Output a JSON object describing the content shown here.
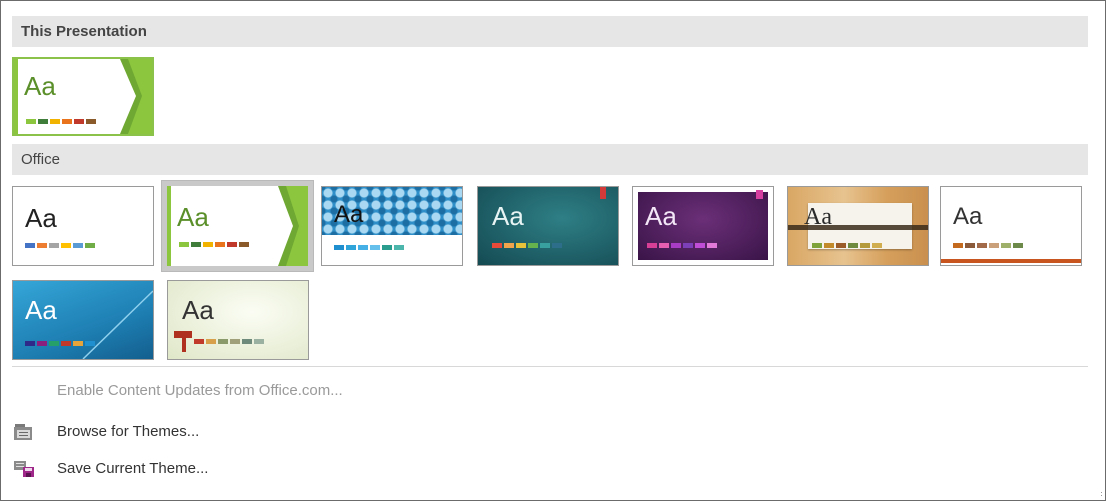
{
  "sections": {
    "this_presentation": "This Presentation",
    "office": "Office"
  },
  "thumbs": {
    "current": {
      "label": "Aa",
      "swatches": [
        "#8cc63f",
        "#3f7d3a",
        "#f2b200",
        "#e8731c",
        "#c0392b",
        "#8a5a2b"
      ]
    },
    "office_theme": {
      "label": "Aa",
      "swatches": [
        "#4472c4",
        "#ed7d31",
        "#a5a5a5",
        "#ffc000",
        "#5b9bd5",
        "#70ad47"
      ]
    },
    "facet": {
      "label": "Aa",
      "swatches": [
        "#8cc63f",
        "#3f7d3a",
        "#f2b200",
        "#e8731c",
        "#c0392b",
        "#8a5a2b"
      ]
    },
    "pattern": {
      "label": "Aa",
      "swatches": [
        "#1f8fcf",
        "#2fa4d8",
        "#44b0e6",
        "#65c0ec",
        "#2a9d8f",
        "#4db6ac"
      ]
    },
    "teal": {
      "label": "Aa",
      "swatches": [
        "#e84a3a",
        "#f0a44b",
        "#e6c23a",
        "#66b24d",
        "#39a0a0",
        "#2d6e8a"
      ]
    },
    "purple": {
      "label": "Aa",
      "swatches": [
        "#d63f95",
        "#e65fb0",
        "#a83cc4",
        "#7d3fb8",
        "#c04dd6",
        "#e27ad9"
      ]
    },
    "wood": {
      "label": "Aa",
      "swatches": [
        "#7fa33a",
        "#c28a2b",
        "#9b5c2a",
        "#6e8a3f",
        "#b59a3c",
        "#d0ad4f"
      ]
    },
    "plain": {
      "label": "Aa",
      "swatches": [
        "#c46a1f",
        "#8a5a3a",
        "#a36a4a",
        "#c9a07a",
        "#9fb06a",
        "#6e8a4a"
      ]
    },
    "blue_slant": {
      "label": "Aa",
      "swatches": [
        "#2e2a8a",
        "#8a1f7d",
        "#25a06a",
        "#c0392b",
        "#e6a43a",
        "#1f8fcf"
      ]
    },
    "sage": {
      "label": "Aa",
      "swatches": [
        "#c0392b",
        "#d8a04b",
        "#8a9a6a",
        "#a0a07a",
        "#6e8a7a",
        "#9ab0a0"
      ]
    }
  },
  "commands": {
    "enable": "Enable Content Updates from Office.com...",
    "browse": "Browse for Themes...",
    "save": "Save Current Theme..."
  },
  "colors": {
    "selected_border": "#b9b9b9",
    "header_bg": "#e6e6e6",
    "accent_green": "#8cc63f"
  }
}
